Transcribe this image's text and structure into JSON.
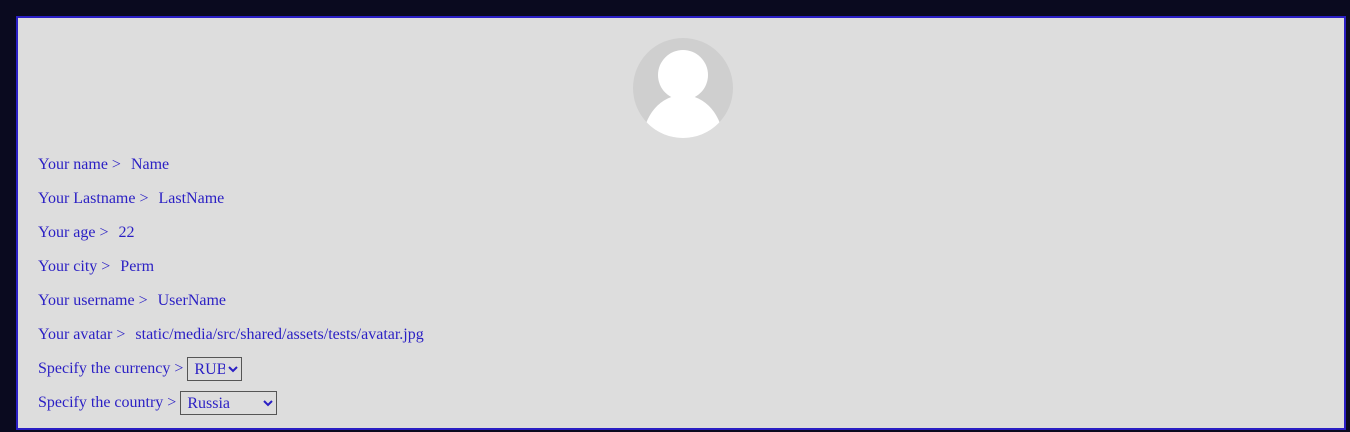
{
  "profile": {
    "avatar_icon": "user-avatar-placeholder-icon",
    "fields": [
      {
        "label": "Your name >",
        "value": "Name"
      },
      {
        "label": "Your Lastname >",
        "value": "LastName"
      },
      {
        "label": "Your age >",
        "value": "22"
      },
      {
        "label": "Your city >",
        "value": "Perm"
      },
      {
        "label": "Your username >",
        "value": "UserName"
      },
      {
        "label": "Your avatar >",
        "value": "static/media/src/shared/assets/tests/avatar.jpg"
      }
    ],
    "currency": {
      "label": "Specify the currency >",
      "selected": "RUB"
    },
    "country": {
      "label": "Specify the country >",
      "selected": "Russia"
    }
  },
  "colors": {
    "background": "#0a0a1f",
    "panel": "#dddddd",
    "accent": "#2a1fc4",
    "avatar_bg": "#cfcfcf"
  }
}
